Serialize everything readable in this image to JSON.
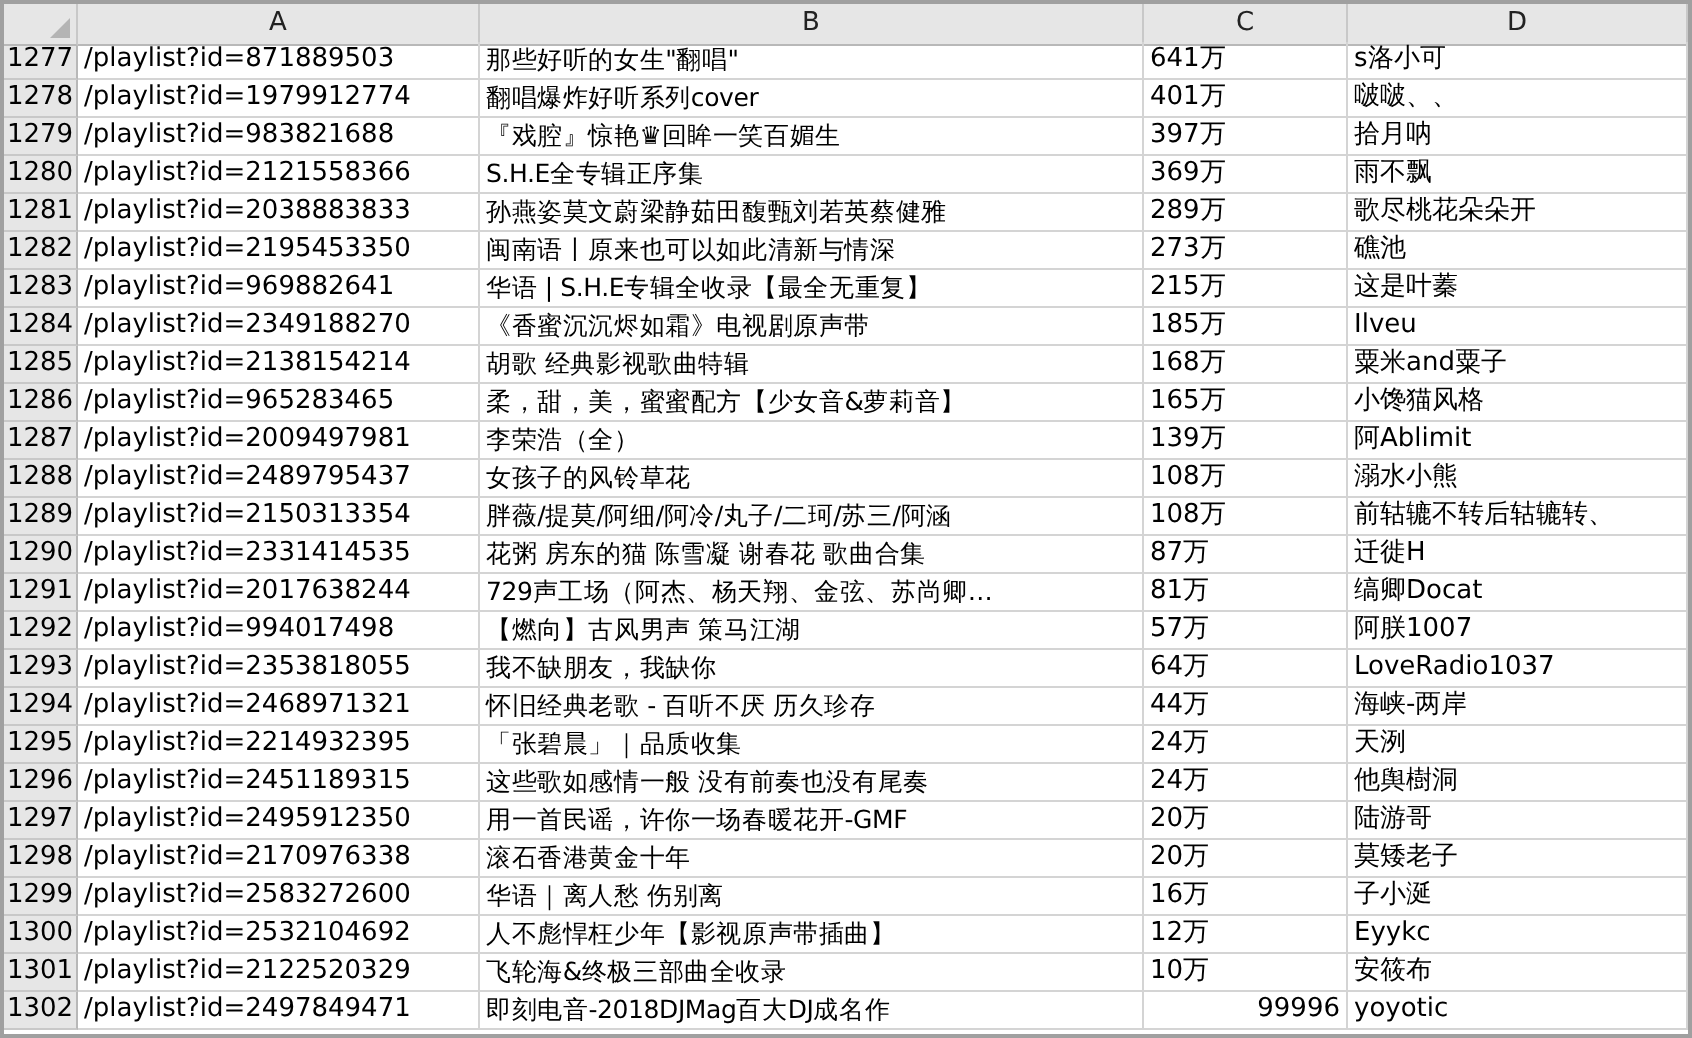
{
  "columns": [
    "A",
    "B",
    "C",
    "D"
  ],
  "rows": [
    {
      "row": "1277",
      "url": "/playlist?id=871889503",
      "title": "那些好听的女生\"翻唱\"",
      "plays": "641万",
      "kind": "text",
      "creator": "s洛小可"
    },
    {
      "row": "1278",
      "url": "/playlist?id=1979912774",
      "title": "翻唱爆炸好听系列cover",
      "plays": "401万",
      "kind": "text",
      "creator": "啵啵、、"
    },
    {
      "row": "1279",
      "url": "/playlist?id=983821688",
      "title": "『戏腔』惊艳♛回眸一笑百媚生",
      "plays": "397万",
      "kind": "text",
      "creator": "拾月呐"
    },
    {
      "row": "1280",
      "url": "/playlist?id=2121558366",
      "title": "S.H.E全专辑正序集",
      "plays": "369万",
      "kind": "text",
      "creator": "雨不飘"
    },
    {
      "row": "1281",
      "url": "/playlist?id=2038883833",
      "title": "孙燕姿莫文蔚梁静茹田馥甄刘若英蔡健雅",
      "plays": "289万",
      "kind": "text",
      "creator": "歌尽桃花朵朵开"
    },
    {
      "row": "1282",
      "url": "/playlist?id=2195453350",
      "title": "闽南语丨原来也可以如此清新与情深",
      "plays": "273万",
      "kind": "text",
      "creator": "礁池"
    },
    {
      "row": "1283",
      "url": "/playlist?id=969882641",
      "title": "华语 | S.H.E专辑全收录【最全无重复】",
      "plays": "215万",
      "kind": "text",
      "creator": "这是叶蓁"
    },
    {
      "row": "1284",
      "url": "/playlist?id=2349188270",
      "title": "《香蜜沉沉烬如霜》电视剧原声带",
      "plays": "185万",
      "kind": "text",
      "creator": "Ilveu"
    },
    {
      "row": "1285",
      "url": "/playlist?id=2138154214",
      "title": "胡歌 经典影视歌曲特辑",
      "plays": "168万",
      "kind": "text",
      "creator": "粟米and粟子"
    },
    {
      "row": "1286",
      "url": "/playlist?id=965283465",
      "title": "柔，甜，美，蜜蜜配方【少女音&萝莉音】",
      "plays": "165万",
      "kind": "text",
      "creator": "小馋猫风格"
    },
    {
      "row": "1287",
      "url": "/playlist?id=2009497981",
      "title": "李荣浩（全）",
      "plays": "139万",
      "kind": "text",
      "creator": "阿Ablimit"
    },
    {
      "row": "1288",
      "url": "/playlist?id=2489795437",
      "title": "女孩子的风铃草花",
      "plays": "108万",
      "kind": "text",
      "creator": "溺水小熊"
    },
    {
      "row": "1289",
      "url": "/playlist?id=2150313354",
      "title": "胖薇/提莫/阿细/阿冷/丸子/二珂/苏三/阿涵",
      "plays": "108万",
      "kind": "text",
      "creator": "前轱辘不转后轱辘转、"
    },
    {
      "row": "1290",
      "url": "/playlist?id=2331414535",
      "title": "花粥 房东的猫 陈雪凝 谢春花 歌曲合集",
      "plays": "87万",
      "kind": "text",
      "creator": "迁徙H"
    },
    {
      "row": "1291",
      "url": "/playlist?id=2017638244",
      "title": "729声工场（阿杰、杨天翔、金弦、苏尚卿…",
      "plays": "81万",
      "kind": "text",
      "creator": "缟卿Docat"
    },
    {
      "row": "1292",
      "url": "/playlist?id=994017498",
      "title": "【燃向】古风男声 策马江湖",
      "plays": "57万",
      "kind": "text",
      "creator": "阿朕1007"
    },
    {
      "row": "1293",
      "url": "/playlist?id=2353818055",
      "title": "我不缺朋友，我缺你",
      "plays": "64万",
      "kind": "text",
      "creator": "LoveRadio1037"
    },
    {
      "row": "1294",
      "url": "/playlist?id=2468971321",
      "title": "怀旧经典老歌 - 百听不厌 历久珍存",
      "plays": "44万",
      "kind": "text",
      "creator": "海峡-两岸"
    },
    {
      "row": "1295",
      "url": "/playlist?id=2214932395",
      "title": "「张碧晨」｜品质收集",
      "plays": "24万",
      "kind": "text",
      "creator": "天洌"
    },
    {
      "row": "1296",
      "url": "/playlist?id=2451189315",
      "title": "这些歌如感情一般 没有前奏也没有尾奏",
      "plays": "24万",
      "kind": "text",
      "creator": "他舆樹洞"
    },
    {
      "row": "1297",
      "url": "/playlist?id=2495912350",
      "title": "用一首民谣，许你一场春暖花开-GMF",
      "plays": "20万",
      "kind": "text",
      "creator": "陆游哥"
    },
    {
      "row": "1298",
      "url": "/playlist?id=2170976338",
      "title": "滚石香港黄金十年",
      "plays": "20万",
      "kind": "text",
      "creator": "莫矮老子"
    },
    {
      "row": "1299",
      "url": "/playlist?id=2583272600",
      "title": "华语｜离人愁 伤别离",
      "plays": "16万",
      "kind": "text",
      "creator": "子小涎"
    },
    {
      "row": "1300",
      "url": "/playlist?id=2532104692",
      "title": "人不彪悍枉少年【影视原声带插曲】",
      "plays": "12万",
      "kind": "text",
      "creator": "Eyykc"
    },
    {
      "row": "1301",
      "url": "/playlist?id=2122520329",
      "title": "飞轮海&终极三部曲全收录",
      "plays": "10万",
      "kind": "text",
      "creator": "安筱布"
    },
    {
      "row": "1302",
      "url": "/playlist?id=2497849471",
      "title": "即刻电音-2018DJMag百大DJ成名作",
      "plays": "99996",
      "kind": "number",
      "creator": "yoyotic"
    }
  ]
}
